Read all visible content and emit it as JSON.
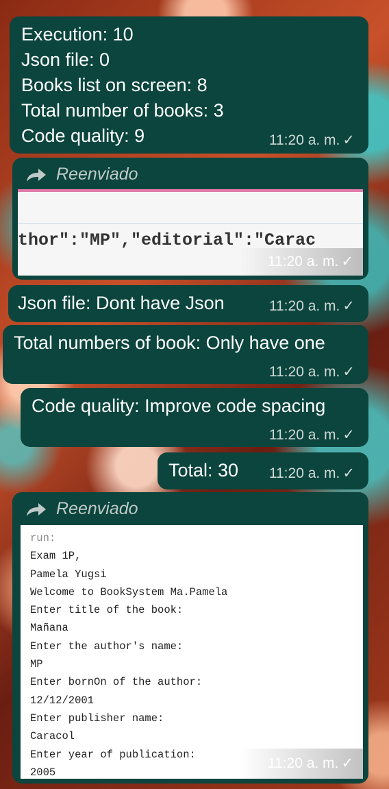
{
  "messages": {
    "m1": {
      "lines": [
        "Execution: 10",
        "Json file: 0",
        "Books list on screen: 8",
        "Total number of books: 3",
        "Code  quality: 9"
      ],
      "time": "11:20 a. m."
    },
    "m2": {
      "forwarded": "Reenviado",
      "code_snippet": "thor\":\"MP\",\"editorial\":\"Carac",
      "time": "11:20 a. m."
    },
    "m3": {
      "text": "Json file: Dont have Json",
      "time": "11:20 a. m."
    },
    "m4": {
      "text": "Total numbers of book: Only have one",
      "time": "11:20 a. m."
    },
    "m5": {
      "text": "Code quality: Improve code spacing",
      "time": "11:20 a. m."
    },
    "m6": {
      "text": "Total: 30",
      "time": "11:20 a. m."
    },
    "m7": {
      "forwarded": "Reenviado",
      "console": [
        "run:",
        "Exam 1P,",
        "Pamela Yugsi",
        "Welcome to BookSystem Ma.Pamela",
        "Enter title of the book:",
        "Mañana",
        "Enter the author's name:",
        "MP",
        "Enter bornOn of the author:",
        "12/12/2001",
        "Enter publisher name:",
        "Caracol",
        "Enter year of publication:",
        "2005"
      ],
      "time": "11:20 a. m."
    }
  },
  "icons": {
    "read_status": "double-check-icon",
    "forward": "forward-arrow-icon"
  }
}
